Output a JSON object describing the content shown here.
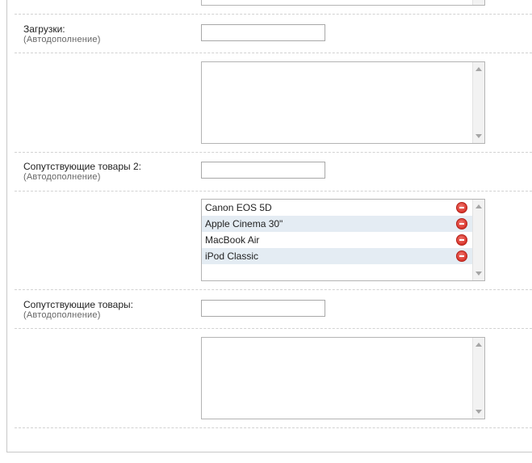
{
  "fields": {
    "downloads": {
      "label": "Загрузки:",
      "hint": "(Автодополнение)",
      "input_value": "",
      "items": []
    },
    "related2": {
      "label": "Сопутствующие товары 2:",
      "hint": "(Автодополнение)",
      "input_value": "",
      "items": [
        "Canon EOS 5D",
        "Apple Cinema 30\"",
        "MacBook Air",
        "iPod Classic"
      ]
    },
    "related": {
      "label": "Сопутствующие товары:",
      "hint": "(Автодополнение)",
      "input_value": "",
      "items": []
    }
  },
  "icons": {
    "remove": "minus-circle-icon",
    "scroll_up": "arrow-up-icon",
    "scroll_down": "arrow-down-icon"
  },
  "colors": {
    "remove_icon": "#d9342b",
    "alt_row": "#e4ecf3"
  }
}
